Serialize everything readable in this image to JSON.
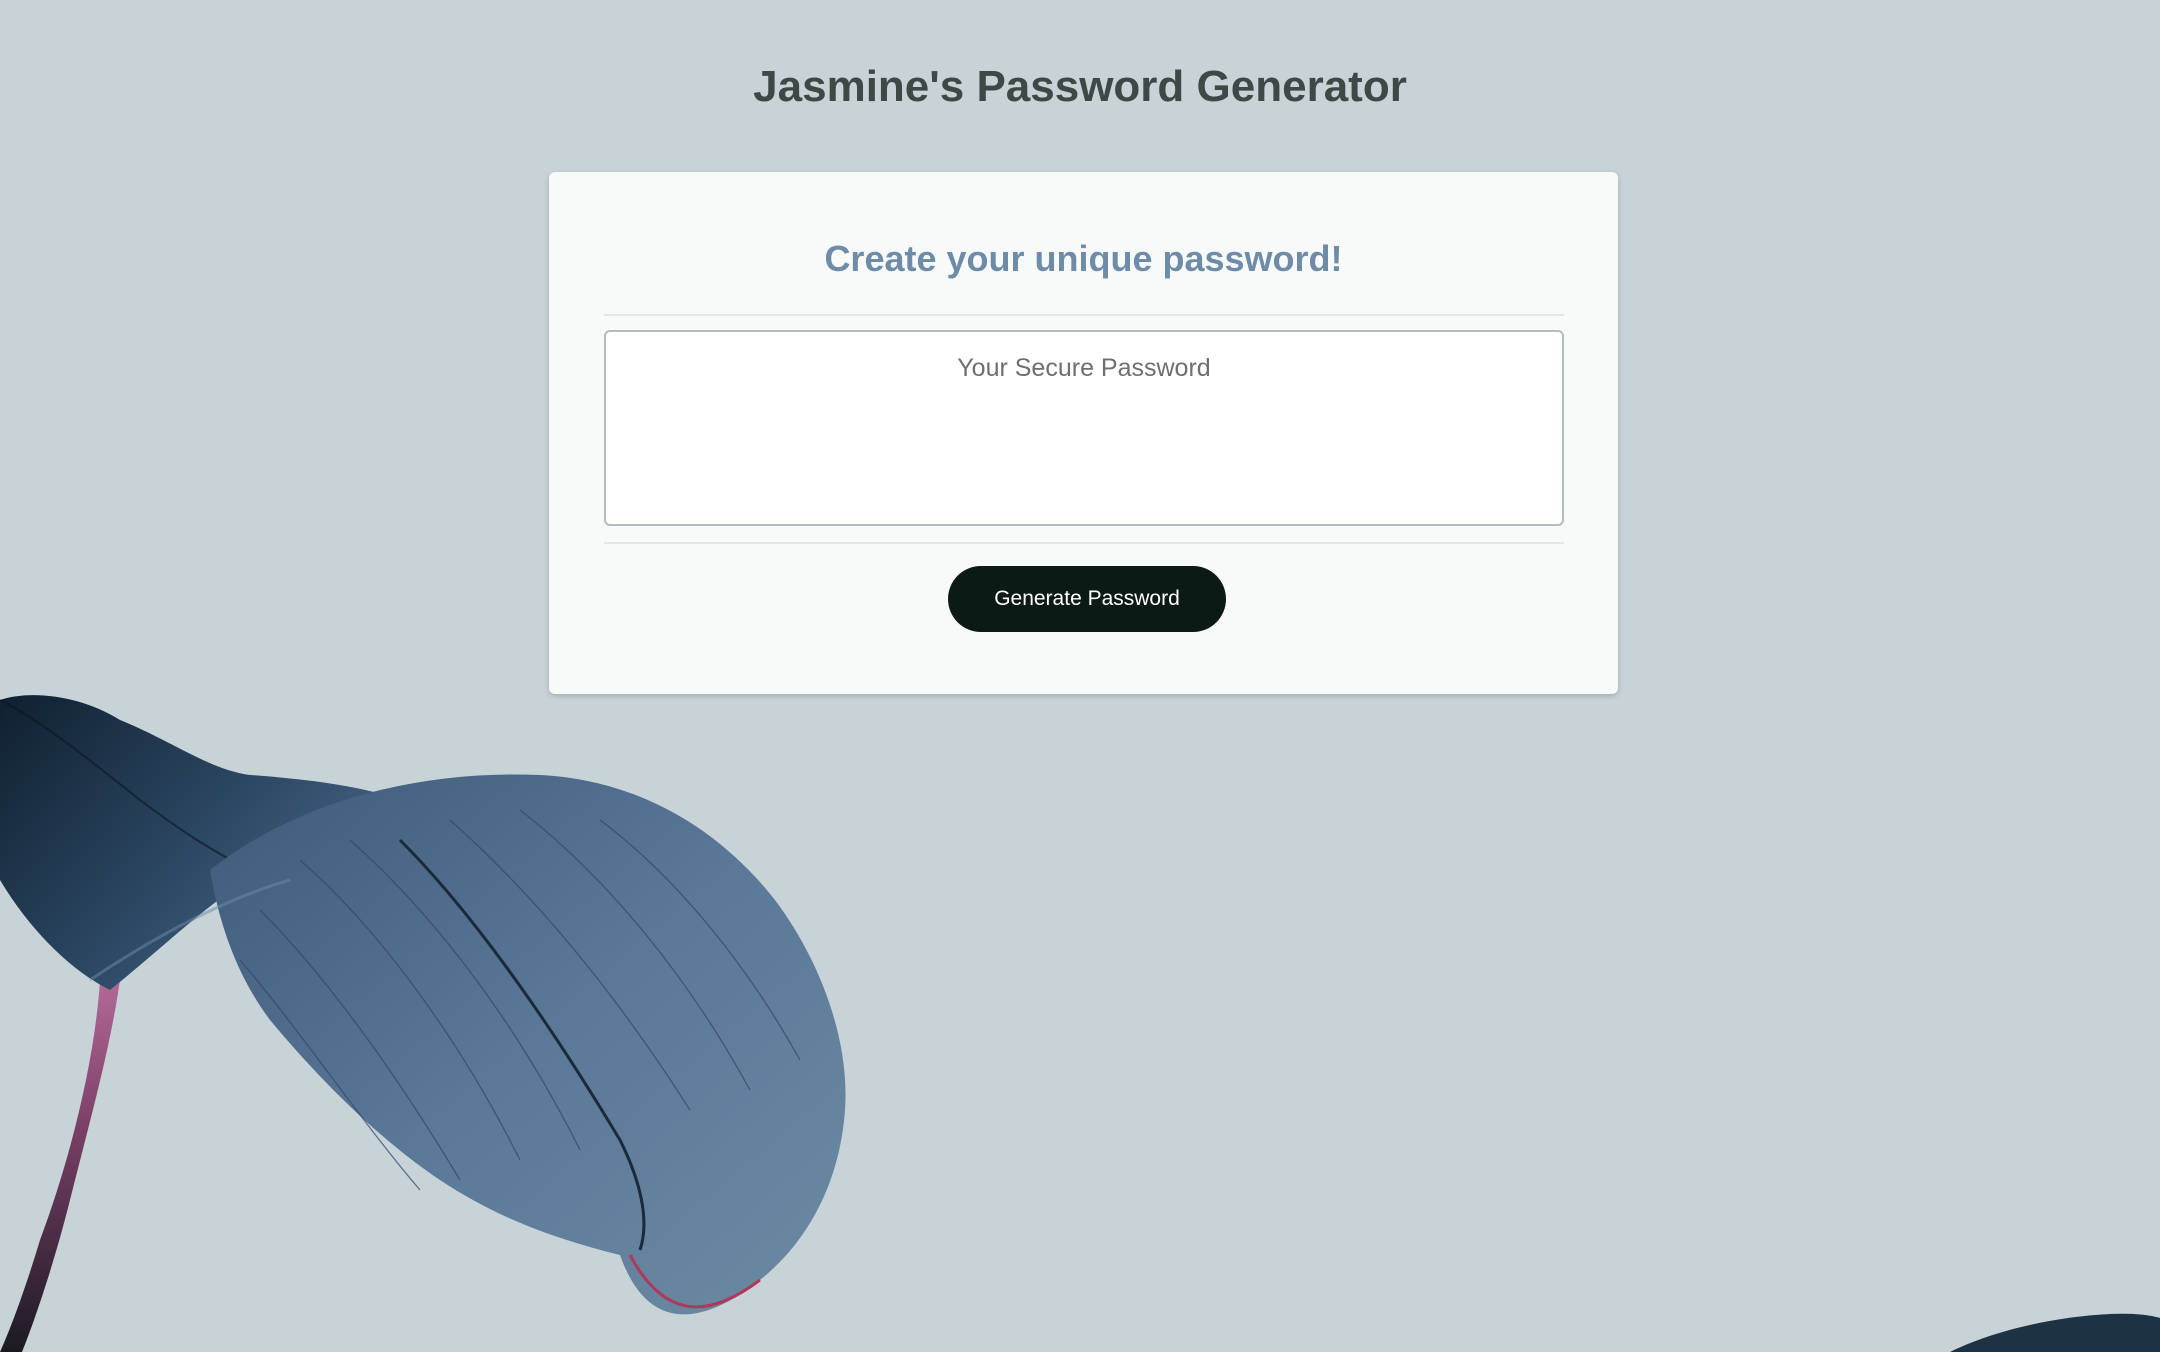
{
  "header": {
    "title": "Jasmine's Password Generator"
  },
  "card": {
    "title": "Create your unique password!",
    "password_placeholder": "Your Secure Password",
    "password_value": "",
    "generate_label": "Generate Password"
  },
  "colors": {
    "background": "#c8d3d8",
    "title_text": "#3c4a46",
    "card_title": "#6e8ba7",
    "button_bg": "#0c1a16",
    "leaf_blue": "#4f6d8f",
    "stem_pink": "#9a4d7a"
  },
  "decor": {
    "leaf": "leaf-illustration"
  }
}
